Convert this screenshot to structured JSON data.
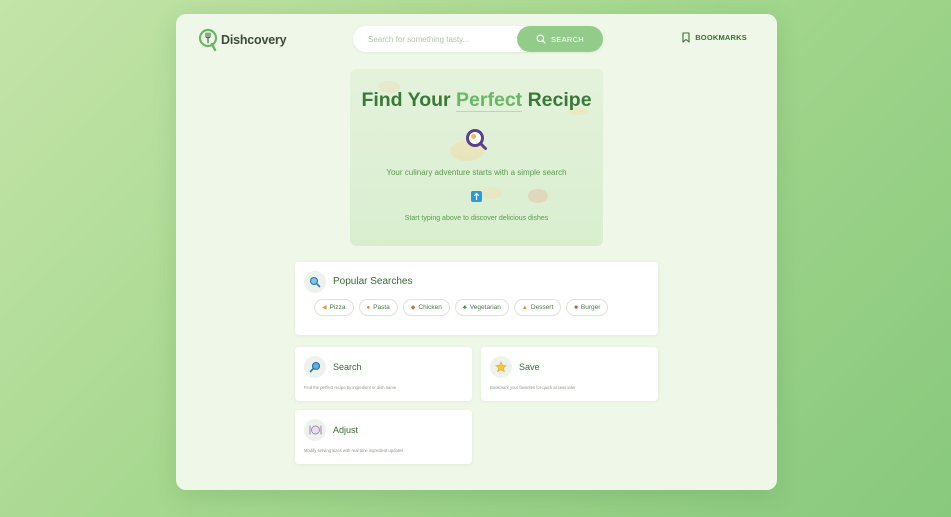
{
  "header": {
    "logo_text": "Dishcovery",
    "search_placeholder": "Search for something tasty...",
    "search_button": "SEARCH",
    "bookmarks_label": "BOOKMARKS"
  },
  "hero": {
    "title_before": "Find Your ",
    "title_accent": "Perfect",
    "title_after": " Recipe",
    "subtitle": "Your culinary adventure starts with a simple search",
    "hint": "Start typing above to discover delicious dishes"
  },
  "popular": {
    "title": "Popular Searches",
    "chips": [
      {
        "icon": "pizza-icon",
        "label": "Pizza"
      },
      {
        "icon": "pasta-icon",
        "label": "Pasta"
      },
      {
        "icon": "chicken-icon",
        "label": "Chicken"
      },
      {
        "icon": "broccoli-icon",
        "label": "Vegetarian"
      },
      {
        "icon": "cake-icon",
        "label": "Dessert"
      },
      {
        "icon": "burger-icon",
        "label": "Burger"
      }
    ]
  },
  "features": [
    {
      "icon": "magnifier-icon",
      "title": "Search",
      "desc": "Find the perfect recipe by ingredient or dish name"
    },
    {
      "icon": "star-icon",
      "title": "Save",
      "desc": "Bookmark your favorites for quick access later"
    },
    {
      "icon": "plate-icon",
      "title": "Adjust",
      "desc": "Modify serving sizes with real-time ingredient updates"
    }
  ],
  "colors": {
    "accent": "#93cb8a",
    "brand": "#3a7a38",
    "background": "#eff8e8"
  }
}
